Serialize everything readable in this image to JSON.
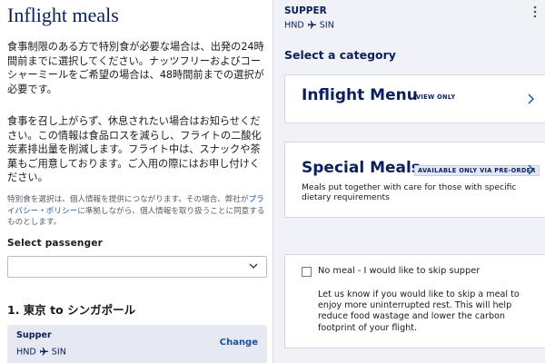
{
  "left": {
    "title": "Inflight meals",
    "para1": "食事制限のある方で特別食が必要な場合は、出発の24時間前までに選択してください。ナッツフリーおよびコーシャーミールをご希望の場合は、48時間前までの選択が必要です。",
    "para2": "食事を召し上がらず、休息されたい場合はお知らせください。この情報は食品ロスを減らし、フライトの二酸化炭素排出量を削減します。フライト中は、スナックや茶菓もご用意しております。ご入用の際にはお申し付けください。",
    "note_before": "特別食を選択は、個人情報を提供につながります。その場合、弊社が",
    "note_link": "プライバシー・ポリシー",
    "note_after": "に準拠しながら、個人情報を取り扱うことに同意するものとします。",
    "select_label": "Select passenger",
    "select_value": "",
    "segment_title": "1. 東京 to シンガポール",
    "segment_card": {
      "meal": "Supper",
      "origin": "HND",
      "destination": "SIN",
      "change_label": "Change"
    }
  },
  "right": {
    "header": {
      "meal": "SUPPER",
      "origin": "HND",
      "destination": "SIN"
    },
    "section_title": "Select a category",
    "cards": [
      {
        "title": "Inflight Menu",
        "badge": "VIEW ONLY"
      },
      {
        "title": "Special Meals",
        "badge": "AVAILABLE ONLY VIA PRE-ORDER",
        "description": "Meals put together with care for those with specific dietary requirements"
      }
    ],
    "skip": {
      "label": "No meal - I would like to skip supper",
      "description": "Let us know if you would like to skip a meal to enjoy more uninterrupted rest. This will help reduce food wastage and lower the carbon footprint of your flight.",
      "checked": false
    }
  },
  "colors": {
    "navy": "#0a1f5c",
    "link": "#1a4fa0",
    "panel_bg": "#f0f2f7"
  }
}
